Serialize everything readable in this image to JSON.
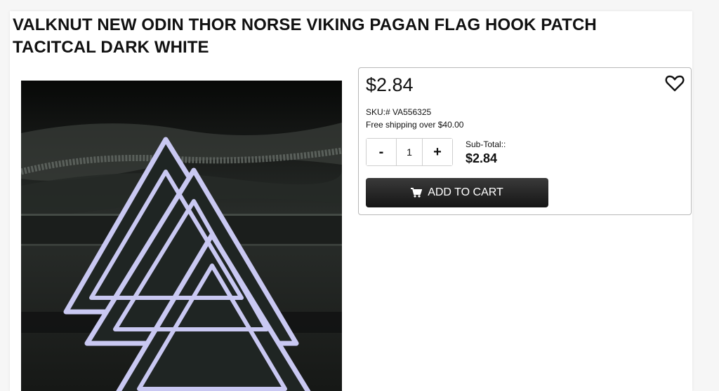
{
  "product": {
    "title": "VALKNUT NEW ODIN THOR NORSE VIKING PAGAN FLAG HOOK PATCH TACITCAL DARK WHITE",
    "image_icon": "valknut-patch-image"
  },
  "purchase": {
    "price": "$2.84",
    "sku_line": "SKU:# VA556325",
    "shipping_line": "Free shipping over $40.00",
    "wishlist_icon": "heart-icon",
    "quantity": {
      "decrement_label": "-",
      "value": "1",
      "increment_label": "+"
    },
    "subtotal_label": "Sub-Total::",
    "subtotal_value": "$2.84",
    "add_to_cart_label": "ADD TO CART",
    "cart_icon": "shopping-cart-icon"
  },
  "colors": {
    "button_dark": "#1c1c1c",
    "patch_fill": "#1f2523",
    "patch_stitch": "#c9c8f2"
  }
}
